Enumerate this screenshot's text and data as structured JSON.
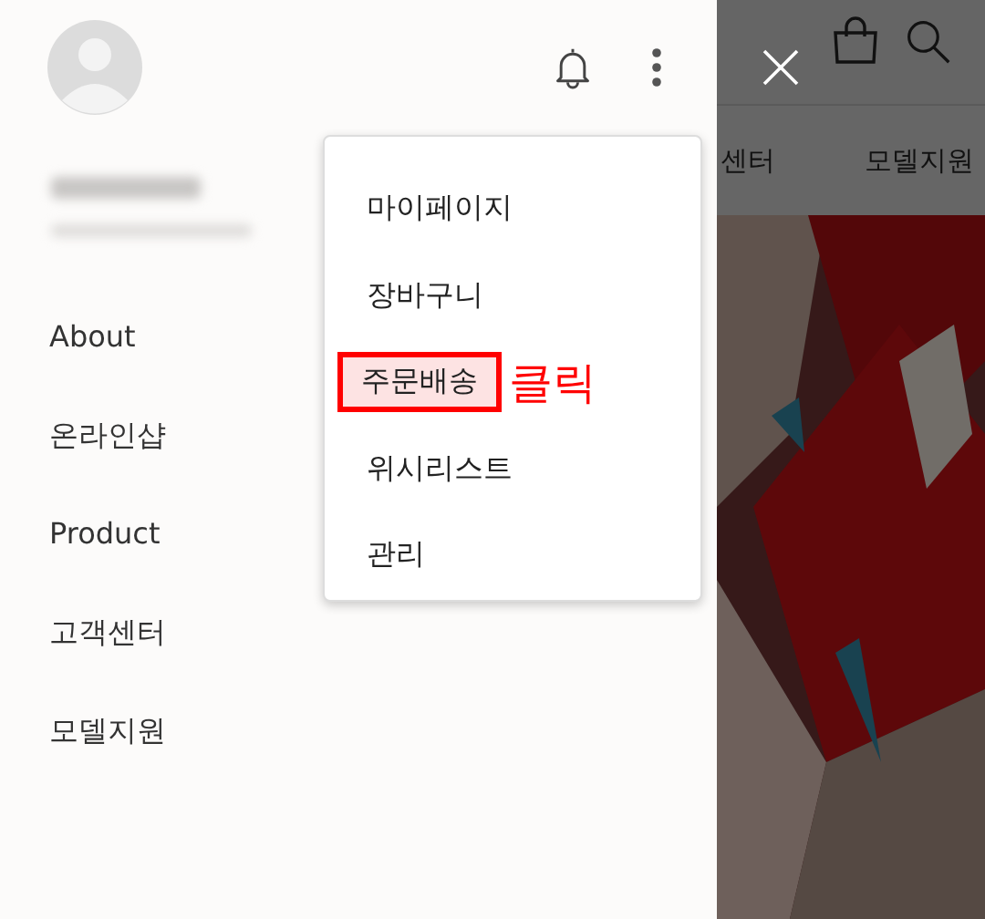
{
  "drawer": {
    "menu": [
      {
        "label": "About"
      },
      {
        "label": "온라인샵"
      },
      {
        "label": "Product"
      },
      {
        "label": "고객센터"
      },
      {
        "label": "모델지원"
      }
    ]
  },
  "popup_menu": {
    "items": [
      {
        "label": "마이페이지",
        "highlighted": false
      },
      {
        "label": "장바구니",
        "highlighted": false
      },
      {
        "label": "주문배송",
        "highlighted": true
      },
      {
        "label": "위시리스트",
        "highlighted": false
      },
      {
        "label": "관리",
        "highlighted": false
      }
    ],
    "annotation": "클릭"
  },
  "page_behind": {
    "nav": [
      "센터",
      "모델지원"
    ]
  }
}
